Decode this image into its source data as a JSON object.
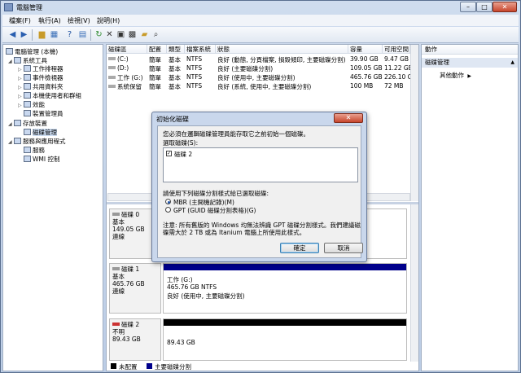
{
  "window": {
    "title": "電腦管理",
    "minimize": "–",
    "maximize": "□",
    "close": "✕"
  },
  "menu": [
    "檔案(F)",
    "執行(A)",
    "檢視(V)",
    "說明(H)"
  ],
  "toolbar_icons": [
    "back-icon",
    "forward-icon",
    "up-folder-icon",
    "show-tree-icon",
    "help-icon",
    "properties-icon",
    "refresh-icon",
    "delete-icon",
    "open-icon",
    "new-icon",
    "explore-icon",
    "search-icon"
  ],
  "tree": {
    "root": "電腦管理 (本機)",
    "items": [
      {
        "label": "系統工具",
        "level": 1,
        "expanded": true
      },
      {
        "label": "工作排程器",
        "level": 2
      },
      {
        "label": "事件檢視器",
        "level": 2
      },
      {
        "label": "共用資料夾",
        "level": 2
      },
      {
        "label": "本機使用者和群組",
        "level": 2
      },
      {
        "label": "效能",
        "level": 2
      },
      {
        "label": "裝置管理員",
        "level": 2
      },
      {
        "label": "存放裝置",
        "level": 1,
        "expanded": true
      },
      {
        "label": "磁碟管理",
        "level": 2,
        "selected": true
      },
      {
        "label": "服務與應用程式",
        "level": 1
      },
      {
        "label": "服務",
        "level": 2
      },
      {
        "label": "WMI 控制",
        "level": 2
      }
    ]
  },
  "volume_table": {
    "columns": [
      "磁碟區",
      "配置",
      "類型",
      "檔案系統",
      "狀態",
      "容量",
      "可用空間"
    ],
    "rows": [
      [
        "(C:)",
        "簡單",
        "基本",
        "NTFS",
        "良好 (動態, 分頁檔案, 損毀傾印, 主要磁碟分割)",
        "39.90 GB",
        "9.47 GB"
      ],
      [
        "(D:)",
        "簡單",
        "基本",
        "NTFS",
        "良好 (主要磁碟分割)",
        "109.05 GB",
        "11.22 GB"
      ],
      [
        "工作 (G:)",
        "簡單",
        "基本",
        "NTFS",
        "良好 (使用中, 主要磁碟分割)",
        "465.76 GB",
        "226.10 GB"
      ],
      [
        "系統保留",
        "簡單",
        "基本",
        "NTFS",
        "良好 (系統, 使用中, 主要磁碟分割)",
        "100 MB",
        "72 MB"
      ]
    ]
  },
  "disks": [
    {
      "name": "磁碟 0",
      "type": "基本",
      "size": "149.05 GB",
      "status": "連線"
    },
    {
      "name": "磁碟 1",
      "type": "基本",
      "size": "465.76 GB",
      "status": "連線",
      "vol_name": "工作 (G:)",
      "vol_size": "465.76 GB NTFS",
      "vol_status": "良好 (使用中, 主要磁碟分割)"
    },
    {
      "name": "磁碟 2",
      "type": "不明",
      "size": "89.43 GB",
      "status": "",
      "vol_size": "89.43 GB"
    }
  ],
  "legend": [
    {
      "label": "未配置",
      "color": "#000000"
    },
    {
      "label": "主要磁碟分割",
      "color": "#00008b"
    }
  ],
  "actions": {
    "header": "動作",
    "section": "磁碟管理",
    "item": "其他動作"
  },
  "dialog": {
    "title": "初始化磁碟",
    "close": "✕",
    "instruction": "您必須在邏輯磁碟管理員能存取它之前初始一個磁碟。",
    "select_label": "選取磁碟(S):",
    "disk_item": "磁碟 2",
    "partition_label": "請使用下列磁碟分割樣式給已選取磁碟:",
    "mbr": "MBR (主開機記錄)(M)",
    "gpt": "GPT (GUID 磁碟分割表格)(G)",
    "note_line1": "注意: 所有舊版的 Windows 均無法辨識 GPT 磁碟分割樣式。我們建議磁",
    "note_line2": "碟需大於 2 TB 或為 Itanium 電腦上所使用此樣式。",
    "ok": "確定",
    "cancel": "取消"
  }
}
